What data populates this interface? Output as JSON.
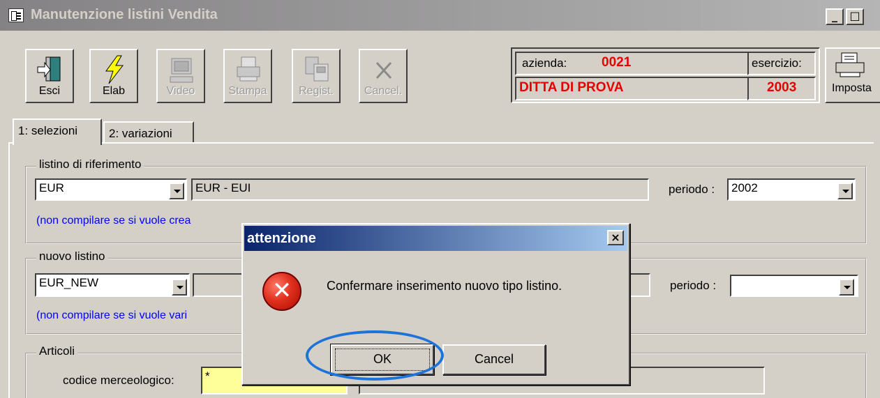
{
  "window": {
    "title": "Manutenzione listini Vendita",
    "caption_buttons": [
      "_",
      "□"
    ]
  },
  "toolbar": {
    "buttons": [
      {
        "label": "Esci",
        "icon": "exit-door-icon",
        "enabled": true
      },
      {
        "label": "Elab",
        "icon": "lightning-icon",
        "enabled": true
      },
      {
        "label": "Video",
        "icon": "monitor-icon",
        "enabled": false
      },
      {
        "label": "Stampa",
        "icon": "printer-icon",
        "enabled": false
      },
      {
        "label": "Regist.",
        "icon": "save-icon",
        "enabled": false
      },
      {
        "label": "Cancel.",
        "icon": "cancel-icon",
        "enabled": false
      }
    ],
    "imposta_label": "Imposta"
  },
  "info": {
    "azienda_label": "azienda:",
    "azienda_code": "0021",
    "azienda_name": "DITTA DI PROVA",
    "esercizio_label": "esercizio:",
    "esercizio_value": "2003",
    "highlight_color": "#e60000"
  },
  "tabs": [
    {
      "label": "1: selezioni",
      "active": true
    },
    {
      "label": "2: variazioni",
      "active": false
    }
  ],
  "ref_group": {
    "title": "listino di riferimento",
    "code": "EUR",
    "description": "EUR - EUI",
    "periodo_label": "periodo :",
    "periodo_value": "2002",
    "note": "(non compilare se si vuole crea"
  },
  "new_group": {
    "title": "nuovo listino",
    "code": "EUR_NEW",
    "description": "",
    "periodo_label": "periodo :",
    "periodo_value": "",
    "note": "(non compilare se si vuole vari"
  },
  "articoli_group": {
    "title": "Articoli",
    "codice_label": "codice merceologico:",
    "codice_value": "*"
  },
  "dialog": {
    "title": "attenzione",
    "close_label": "×",
    "icon": "error-icon",
    "message": "Confermare inserimento nuovo tipo listino.",
    "ok_label": "OK",
    "cancel_label": "Cancel",
    "title_color": "#0a246a",
    "annotation_color": "#1e73d8"
  }
}
